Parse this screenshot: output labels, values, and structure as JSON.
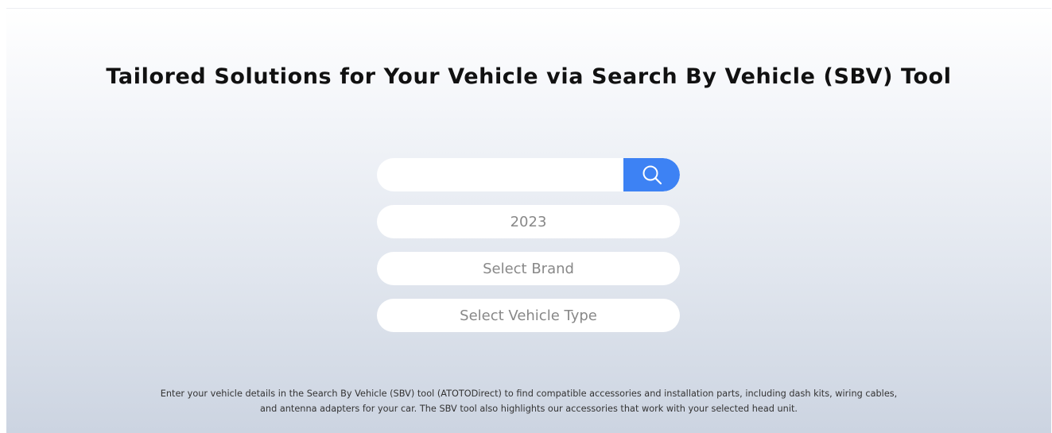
{
  "header": {
    "title": "Tailored Solutions for Your Vehicle via Search By Vehicle (SBV) Tool"
  },
  "search": {
    "value": "",
    "placeholder": "",
    "button_icon": "search-icon",
    "accent_color": "#3d82f4"
  },
  "selectors": {
    "year": "2023",
    "brand": "Select Brand",
    "vehicle_type": "Select Vehicle Type"
  },
  "description": {
    "line1": "Enter your vehicle details in the Search By Vehicle (SBV) tool (ATOTODirect) to find compatible accessories and installation parts, including dash kits, wiring cables,",
    "line2": "and antenna adapters for your car. The SBV tool also highlights our accessories that work with your selected head unit."
  }
}
